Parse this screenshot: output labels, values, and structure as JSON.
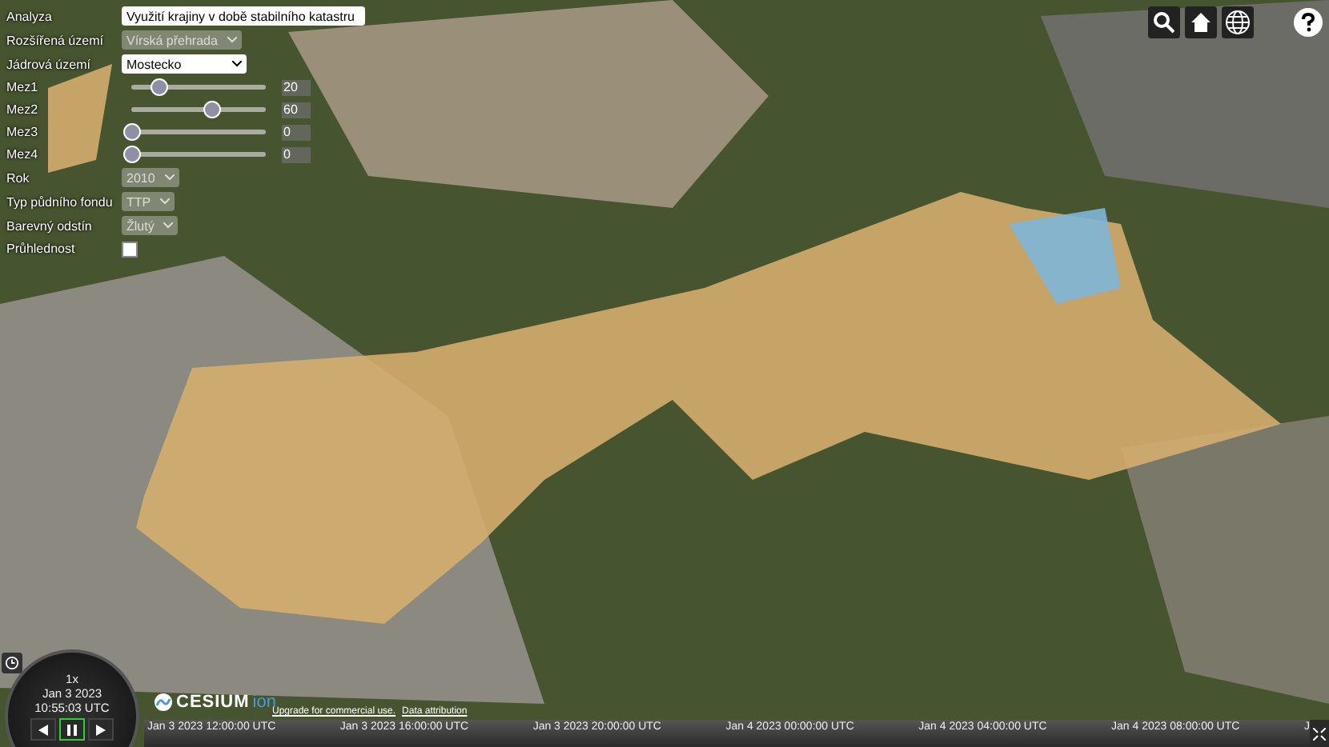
{
  "panel": {
    "rows": [
      {
        "kind": "select",
        "label": "Analyza",
        "value": "Využití krajiny v době stabilního katastru",
        "disabled": false,
        "wide": true
      },
      {
        "kind": "select",
        "label": "Rozšířená území",
        "value": "Vírská přehrada",
        "disabled": true,
        "wide": false
      },
      {
        "kind": "select",
        "label": "Jádrová území",
        "value": "Mostecko",
        "disabled": false,
        "wide": false
      },
      {
        "kind": "slider",
        "label": "Mez1",
        "level": 0.2,
        "value": "20"
      },
      {
        "kind": "slider",
        "label": "Mez2",
        "level": 0.6,
        "value": "60"
      },
      {
        "kind": "slider",
        "label": "Mez3",
        "level": 0,
        "value": "0"
      },
      {
        "kind": "slider",
        "label": "Mez4",
        "level": 0,
        "value": "0"
      },
      {
        "kind": "select",
        "label": "Rok",
        "value": "2010",
        "disabled": true,
        "wide": false
      },
      {
        "kind": "select",
        "label": "Typ půdního fondu",
        "value": "TTP",
        "disabled": true,
        "wide": false
      },
      {
        "kind": "select",
        "label": "Barevný odstín",
        "value": "Žlutý",
        "disabled": true,
        "wide": false
      },
      {
        "kind": "checkbox",
        "label": "Průhlednost",
        "checked": false
      }
    ]
  },
  "clock": {
    "speed": "1x",
    "date": "Jan 3 2023",
    "time": "10:55:03 UTC",
    "paused": true
  },
  "logo": {
    "name": "CESIUM",
    "suffix": "ion"
  },
  "credits": [
    {
      "text": "Upgrade for commercial use."
    },
    {
      "text": "Data attribution"
    }
  ],
  "timeline": {
    "labels": [
      "Jan 3 2023 12:00:00 UTC",
      "Jan 3 2023 16:00:00 UTC",
      "Jan 3 2023 20:00:00 UTC",
      "Jan 4 2023 00:00:00 UTC",
      "Jan 4 2023 04:00:00 UTC",
      "Jan 4 2023 08:00:00 UTC",
      "J"
    ]
  }
}
